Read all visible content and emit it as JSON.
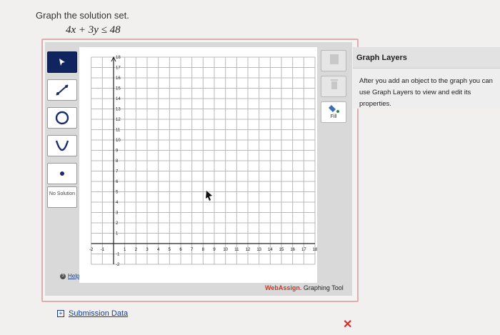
{
  "question": {
    "prompt": "Graph the solution set.",
    "inequality": "4x + 3y ≤ 48"
  },
  "tools": {
    "items": [
      {
        "name": "pointer",
        "active": true
      },
      {
        "name": "line"
      },
      {
        "name": "circle"
      },
      {
        "name": "parabola"
      },
      {
        "name": "point"
      }
    ],
    "no_solution_label": "No Solution",
    "help_label": "Help",
    "right": {
      "delete_label": "Delete",
      "fill_label": "Fill"
    }
  },
  "graph": {
    "x_range": [
      -2,
      18
    ],
    "y_range": [
      -2,
      18
    ],
    "x_ticks": [
      "-2",
      "-1",
      "1",
      "2",
      "3",
      "4",
      "5",
      "6",
      "7",
      "8",
      "9",
      "10",
      "11",
      "12",
      "13",
      "14",
      "15",
      "16",
      "17",
      "18"
    ],
    "y_ticks": [
      "18",
      "17",
      "16",
      "15",
      "14",
      "13",
      "12",
      "11",
      "10",
      "9",
      "8",
      "7",
      "6",
      "5",
      "4",
      "3",
      "2",
      "1",
      "-1",
      "-2"
    ]
  },
  "brand": {
    "part1": "WebAssign",
    "part2": ". Graphing Tool"
  },
  "layers": {
    "title": "Graph Layers",
    "help": "After you add an object to the graph you can use Graph Layers to view and edit its properties."
  },
  "submission": {
    "box": "+",
    "label": "Submission Data"
  },
  "status": {
    "mark": "✕",
    "color": "#d03030"
  },
  "colors": {
    "active_tool": "#10245f",
    "frame_border": "#d8b0b0",
    "link": "#1a3d8a"
  }
}
